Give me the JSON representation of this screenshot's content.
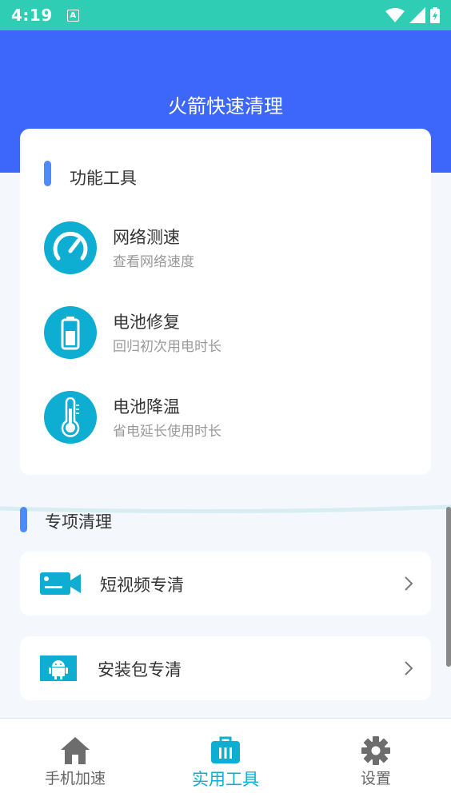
{
  "status_bar": {
    "time": "4:19",
    "notification_letter": "A"
  },
  "header": {
    "title": "火箭快速清理"
  },
  "tools_section": {
    "title": "功能工具",
    "items": [
      {
        "name": "网络测速",
        "desc": "查看网络速度",
        "icon": "speedometer-icon"
      },
      {
        "name": "电池修复",
        "desc": "回归初次用电时长",
        "icon": "battery-icon"
      },
      {
        "name": "电池降温",
        "desc": "省电延长使用时长",
        "icon": "thermometer-icon"
      }
    ]
  },
  "special_section": {
    "title": "专项清理",
    "items": [
      {
        "label": "短视频专清",
        "icon": "video-camera-icon"
      },
      {
        "label": "安装包专清",
        "icon": "android-package-icon"
      }
    ]
  },
  "bottom_nav": {
    "items": [
      {
        "label": "手机加速",
        "icon": "home-icon"
      },
      {
        "label": "实用工具",
        "icon": "toolbox-icon",
        "active": true
      },
      {
        "label": "设置",
        "icon": "gear-icon"
      }
    ]
  },
  "colors": {
    "status_bar": "#2fcdb4",
    "header": "#3d66fb",
    "accent": "#0eaed3",
    "section_bar": "#4c8bfa"
  }
}
